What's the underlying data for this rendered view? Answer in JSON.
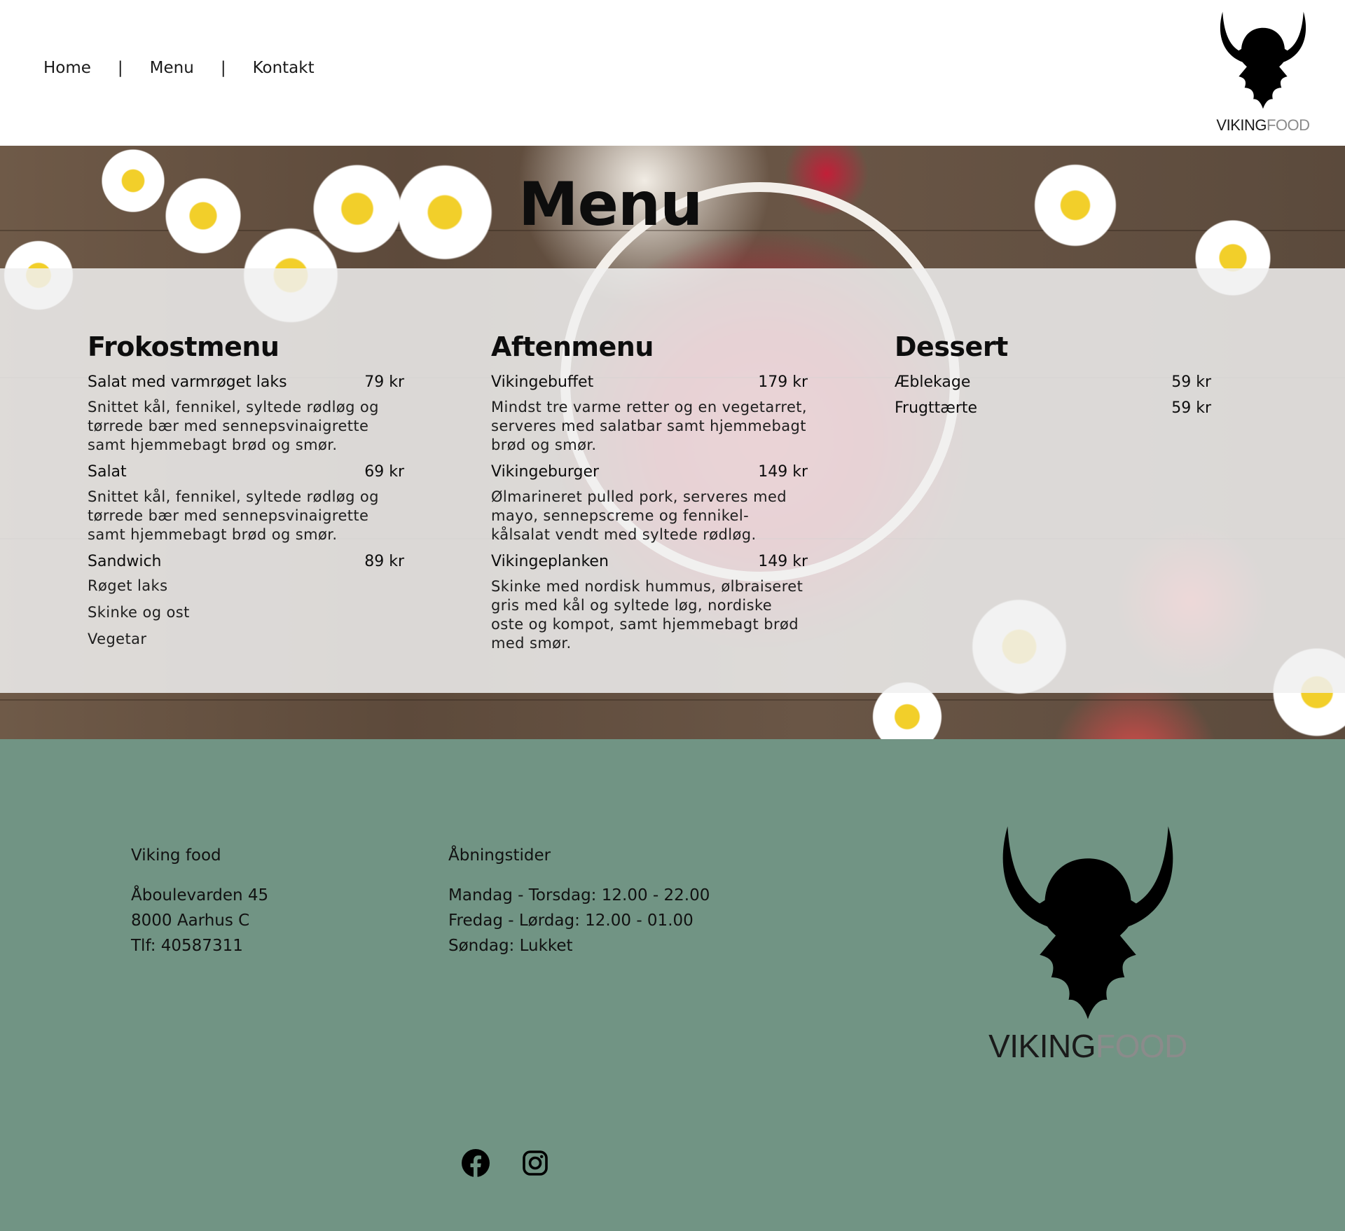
{
  "nav": {
    "items": [
      {
        "label": "Home"
      },
      {
        "label": "Menu"
      },
      {
        "label": "Kontakt"
      }
    ],
    "separator": "|"
  },
  "logo": {
    "word_dark": "VIKING",
    "word_light": "FOOD"
  },
  "menu": {
    "title": "Menu",
    "frokost": {
      "heading": "Frokostmenu",
      "items": [
        {
          "name": "Salat med varmrøget laks",
          "price": "79 kr",
          "desc": "Snittet kål, fennikel, syltede rødløg og tørrede bær med sennepsvinaigrette samt hjemmebagt brød og smør."
        },
        {
          "name": "Salat",
          "price": "69 kr",
          "desc": "Snittet kål, fennikel, syltede rødløg og tørrede bær med sennepsvinaigrette samt hjemmebagt brød og smør."
        },
        {
          "name": "Sandwich",
          "price": "89 kr",
          "options": [
            "Røget laks",
            "Skinke og ost",
            "Vegetar"
          ]
        }
      ]
    },
    "aften": {
      "heading": "Aftenmenu",
      "items": [
        {
          "name": "Vikingebuffet",
          "price": "179 kr",
          "desc": "Mindst tre varme retter og en vegetarret, serveres med salatbar samt hjemmebagt brød og smør."
        },
        {
          "name": "Vikingeburger",
          "price": "149 kr",
          "desc": "Ølmarineret pulled pork, serveres med mayo, sennepscreme og fennikel-kålsalat vendt med syltede rødløg."
        },
        {
          "name": "Vikingeplanken",
          "price": "149 kr",
          "desc": "Skinke med nordisk hummus, ølbraiseret gris med kål og syltede løg, nordiske oste og kompot, samt hjemmebagt brød med smør."
        }
      ]
    },
    "dessert": {
      "heading": "Dessert",
      "items": [
        {
          "name": "Æblekage",
          "price": "59 kr"
        },
        {
          "name": "Frugttærte",
          "price": "59 kr"
        }
      ]
    }
  },
  "footer": {
    "contact": {
      "heading": "Viking food",
      "lines": [
        "Åboulevarden 45",
        "8000 Aarhus C",
        "Tlf: 40587311"
      ]
    },
    "hours": {
      "heading": "Åbningstider",
      "lines": [
        "Mandag - Torsdag: 12.00 - 22.00",
        "Fredag -  Lørdag: 12.00 - 01.00",
        "Søndag:  Lukket"
      ]
    },
    "social": [
      {
        "icon": "facebook-icon"
      },
      {
        "icon": "instagram-icon"
      }
    ]
  },
  "colors": {
    "footer_bg": "#719484",
    "panel_bg": "#f0f0f0",
    "text": "#111111",
    "logo_light": "#8b8b8b"
  }
}
